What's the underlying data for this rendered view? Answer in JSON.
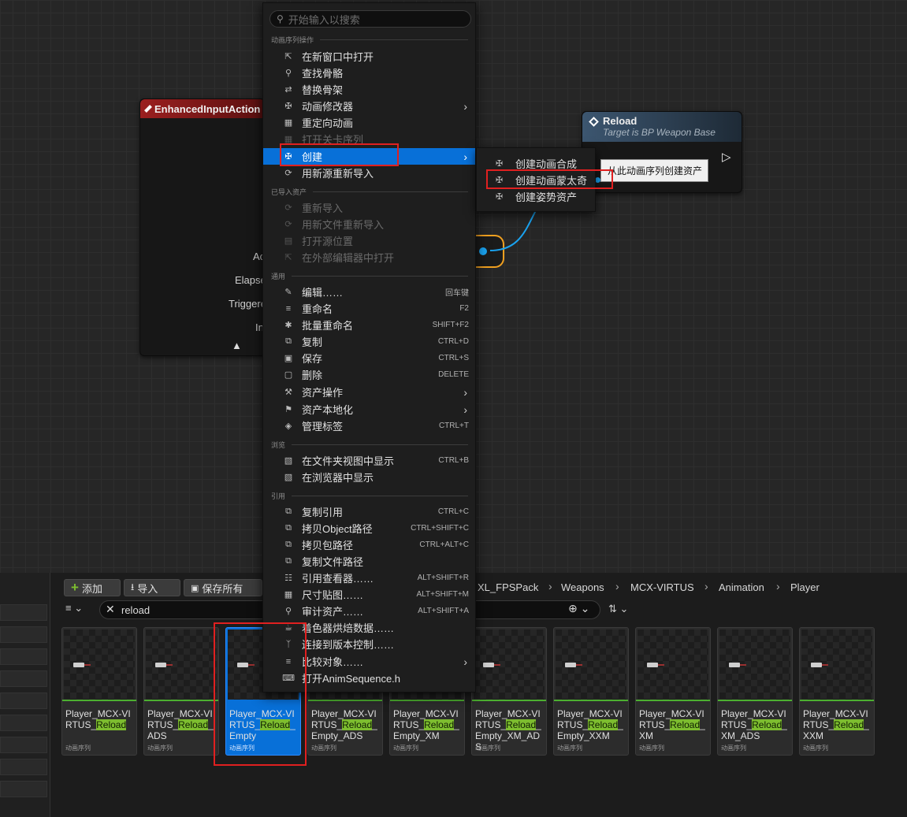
{
  "search": {
    "placeholder": "开始输入以搜索"
  },
  "menu": {
    "sections": [
      {
        "title": "动画序列操作",
        "items": [
          {
            "label": "在新窗口中打开",
            "icon": "open-window-icon",
            "shortcut": "",
            "submenu": false,
            "disabled": false
          },
          {
            "label": "查找骨骼",
            "icon": "find-skeleton-icon",
            "shortcut": "",
            "submenu": false,
            "disabled": false
          },
          {
            "label": "替换骨架",
            "icon": "replace-skeleton-icon",
            "shortcut": "",
            "submenu": false,
            "disabled": false
          },
          {
            "label": "动画修改器",
            "icon": "anim-modifier-icon",
            "shortcut": "",
            "submenu": true,
            "disabled": false
          },
          {
            "label": "重定向动画",
            "icon": "retarget-icon",
            "shortcut": "",
            "submenu": false,
            "disabled": false
          },
          {
            "label": "打开关卡序列",
            "icon": "level-sequence-icon",
            "shortcut": "",
            "submenu": false,
            "disabled": true
          },
          {
            "label": "创建",
            "icon": "create-icon",
            "shortcut": "",
            "submenu": true,
            "disabled": false,
            "selected": true
          },
          {
            "label": "用新源重新导入",
            "icon": "reimport-icon",
            "shortcut": "",
            "submenu": false,
            "disabled": false
          }
        ]
      },
      {
        "title": "已导入资产",
        "items": [
          {
            "label": "重新导入",
            "icon": "reimport-icon",
            "shortcut": "",
            "submenu": false,
            "disabled": true
          },
          {
            "label": "用新文件重新导入",
            "icon": "reimport-file-icon",
            "shortcut": "",
            "submenu": false,
            "disabled": true
          },
          {
            "label": "打开源位置",
            "icon": "open-source-icon",
            "shortcut": "",
            "submenu": false,
            "disabled": true
          },
          {
            "label": "在外部编辑器中打开",
            "icon": "external-editor-icon",
            "shortcut": "",
            "submenu": false,
            "disabled": true
          }
        ]
      },
      {
        "title": "通用",
        "items": [
          {
            "label": "编辑……",
            "icon": "edit-icon",
            "shortcut": "回车键",
            "submenu": false,
            "disabled": false
          },
          {
            "label": "重命名",
            "icon": "rename-icon",
            "shortcut": "F2",
            "submenu": false,
            "disabled": false
          },
          {
            "label": "批量重命名",
            "icon": "batch-rename-icon",
            "shortcut": "SHIFT+F2",
            "submenu": false,
            "disabled": false
          },
          {
            "label": "复制",
            "icon": "duplicate-icon",
            "shortcut": "CTRL+D",
            "submenu": false,
            "disabled": false
          },
          {
            "label": "保存",
            "icon": "save-icon",
            "shortcut": "CTRL+S",
            "submenu": false,
            "disabled": false
          },
          {
            "label": "删除",
            "icon": "delete-icon",
            "shortcut": "DELETE",
            "submenu": false,
            "disabled": false
          },
          {
            "label": "资产操作",
            "icon": "asset-actions-icon",
            "shortcut": "",
            "submenu": true,
            "disabled": false
          },
          {
            "label": "资产本地化",
            "icon": "localization-icon",
            "shortcut": "",
            "submenu": true,
            "disabled": false
          },
          {
            "label": "管理标签",
            "icon": "tag-icon",
            "shortcut": "CTRL+T",
            "submenu": false,
            "disabled": false
          }
        ]
      },
      {
        "title": "浏览",
        "items": [
          {
            "label": "在文件夹视图中显示",
            "icon": "folder-view-icon",
            "shortcut": "CTRL+B",
            "submenu": false,
            "disabled": false
          },
          {
            "label": "在浏览器中显示",
            "icon": "explorer-icon",
            "shortcut": "",
            "submenu": false,
            "disabled": false
          }
        ]
      },
      {
        "title": "引用",
        "items": [
          {
            "label": "复制引用",
            "icon": "copy-reference-icon",
            "shortcut": "CTRL+C",
            "submenu": false,
            "disabled": false
          },
          {
            "label": "拷贝Object路径",
            "icon": "copy-path-icon",
            "shortcut": "CTRL+SHIFT+C",
            "submenu": false,
            "disabled": false
          },
          {
            "label": "拷贝包路径",
            "icon": "copy-package-path-icon",
            "shortcut": "CTRL+ALT+C",
            "submenu": false,
            "disabled": false
          },
          {
            "label": "复制文件路径",
            "icon": "copy-file-path-icon",
            "shortcut": "",
            "submenu": false,
            "disabled": false
          },
          {
            "label": "引用查看器……",
            "icon": "reference-viewer-icon",
            "shortcut": "ALT+SHIFT+R",
            "submenu": false,
            "disabled": false
          },
          {
            "label": "尺寸贴图……",
            "icon": "size-map-icon",
            "shortcut": "ALT+SHIFT+M",
            "submenu": false,
            "disabled": false
          },
          {
            "label": "审计资产……",
            "icon": "audit-icon",
            "shortcut": "ALT+SHIFT+A",
            "submenu": false,
            "disabled": false
          },
          {
            "label": "着色器烘焙数据……",
            "icon": "shader-cook-icon",
            "shortcut": "",
            "submenu": false,
            "disabled": false
          },
          {
            "label": "连接到版本控制……",
            "icon": "source-control-icon",
            "shortcut": "",
            "submenu": false,
            "disabled": false
          },
          {
            "label": "比较对象……",
            "icon": "diff-icon",
            "shortcut": "",
            "submenu": true,
            "disabled": false
          },
          {
            "label": "打开AnimSequence.h",
            "icon": "cpp-file-icon",
            "shortcut": "",
            "submenu": false,
            "disabled": false
          }
        ]
      }
    ]
  },
  "submenu": {
    "items": [
      "创建动画合成",
      "创建动画蒙太奇",
      "创建姿势资产"
    ]
  },
  "tooltip": "从此动画序列创建资产",
  "graph": {
    "enhanced_node_title": "EnhancedInputAction",
    "enhanced_pins": [
      "Ac",
      "Elapse",
      "Triggere",
      "In"
    ],
    "reload_node_title": "Reload",
    "reload_node_subtitle": "Target is BP Weapon Base"
  },
  "content_browser": {
    "toolbar": {
      "add": "添加",
      "import": "导入",
      "save_all": "保存所有"
    },
    "breadcrumb": [
      "XL_FPSPack",
      "Weapons",
      "MCX-VIRTUS",
      "Animation",
      "Player"
    ],
    "filter_text": "reload",
    "asset_type": "动画序列",
    "highlight": "Reload",
    "assets": [
      {
        "pre": "Player_MCX-VIRTUS_",
        "post": ""
      },
      {
        "pre": "Player_MCX-VIRTUS_",
        "post": "_ADS"
      },
      {
        "pre": "Player_MCX-VIRTUS_",
        "post": "_Empty",
        "selected": true
      },
      {
        "pre": "Player_MCX-VIRTUS_",
        "post": "_Empty_ADS"
      },
      {
        "pre": "Player_MCX-VIRTUS_",
        "post": "_Empty_XM"
      },
      {
        "pre": "Player_MCX-VIRTUS_",
        "post": "_Empty_XM_ADS"
      },
      {
        "pre": "Player_MCX-VIRTUS_",
        "post": "_Empty_XXM"
      },
      {
        "pre": "Player_MCX-VIRTUS_",
        "post": "_XM"
      },
      {
        "pre": "Player_MCX-VIRTUS_",
        "post": "_XM_ADS"
      },
      {
        "pre": "Player_MCX-VIRTUS_",
        "post": "_XXM"
      }
    ]
  },
  "colors": {
    "selection": "#0870d8",
    "highlight": "#7dbd2f",
    "annotation": "#e02020",
    "node_header": "#8a1c1c",
    "wire": "#1aa3f0"
  }
}
